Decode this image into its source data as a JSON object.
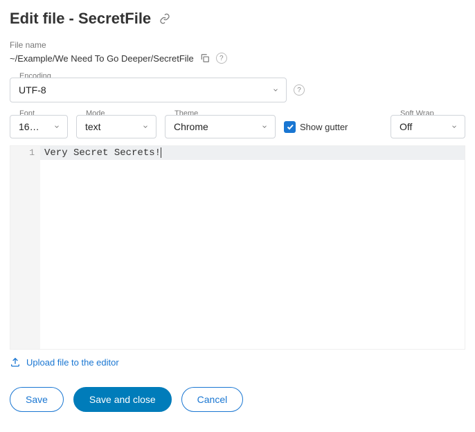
{
  "title": "Edit file - SecretFile",
  "file_name": {
    "label": "File name",
    "value": "~/Example/We Need To Go Deeper/SecretFile"
  },
  "encoding": {
    "label": "Encoding",
    "value": "UTF-8"
  },
  "font": {
    "label": "Font",
    "value": "16…"
  },
  "mode": {
    "label": "Mode",
    "value": "text"
  },
  "theme": {
    "label": "Theme",
    "value": "Chrome"
  },
  "show_gutter": {
    "label": "Show gutter",
    "checked": true
  },
  "soft_wrap": {
    "label": "Soft Wrap",
    "value": "Off"
  },
  "editor": {
    "line_number": "1",
    "content": "Very Secret Secrets!"
  },
  "upload_label": "Upload file to the editor",
  "buttons": {
    "save": "Save",
    "save_close": "Save and close",
    "cancel": "Cancel"
  }
}
